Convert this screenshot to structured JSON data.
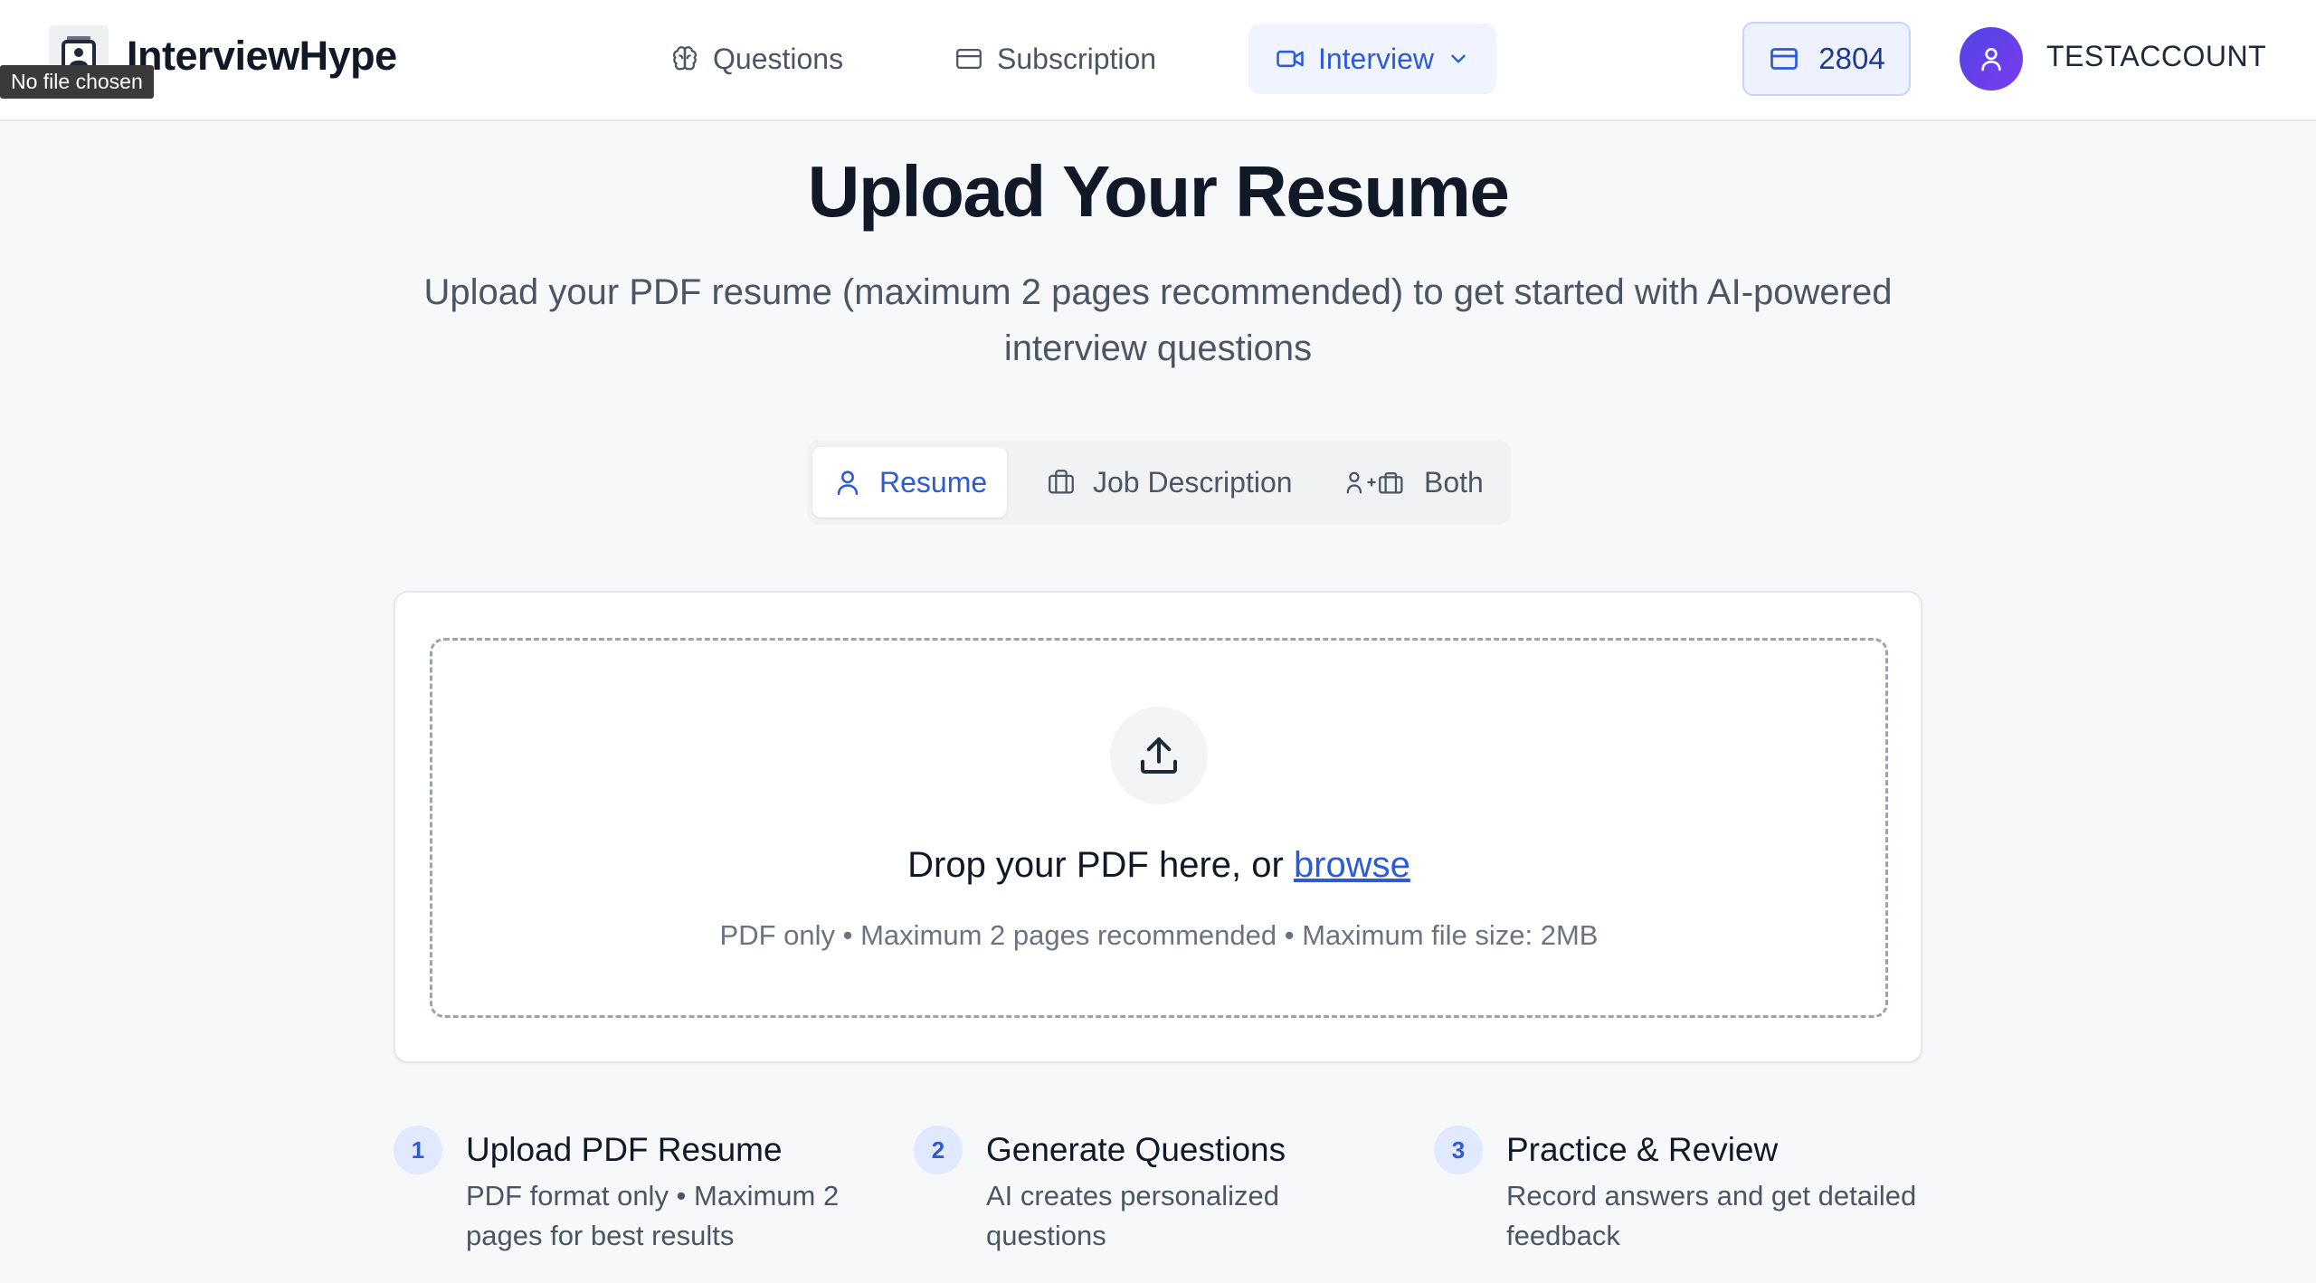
{
  "header": {
    "brand": "InterviewHype",
    "file_tooltip": "No file chosen",
    "nav": {
      "questions": "Questions",
      "subscription": "Subscription",
      "interview": "Interview"
    },
    "credits": "2804",
    "username": "TESTACCOUNT"
  },
  "hero": {
    "title": "Upload Your Resume",
    "subtitle": "Upload your PDF resume (maximum 2 pages recommended) to get started with AI-powered interview questions"
  },
  "tabs": {
    "resume": "Resume",
    "job_description": "Job Description",
    "both": "Both",
    "active": "Resume"
  },
  "upload": {
    "drop_text": "Drop your PDF here, or",
    "browse": "browse",
    "hint": "PDF only • Maximum 2 pages recommended • Maximum file size: 2MB"
  },
  "steps": [
    {
      "number": "1",
      "title": "Upload PDF Resume",
      "description": "PDF format only • Maximum 2 pages for best results"
    },
    {
      "number": "2",
      "title": "Generate Questions",
      "description": "AI creates personalized questions"
    },
    {
      "number": "3",
      "title": "Practice & Review",
      "description": "Record answers and get detailed feedback"
    }
  ],
  "colors": {
    "accent": "#2d5bd7",
    "accent_bg": "#eff4ff",
    "avatar_gradient_start": "#4f46e5",
    "avatar_gradient_end": "#7c3aed",
    "page_bg": "#f7f8fa"
  },
  "icons": {
    "logo": "resume-logo-icon",
    "questions": "brain-icon",
    "subscription": "credit-card-icon",
    "interview": "video-camera-icon",
    "credits": "credit-card-icon",
    "avatar": "user-icon",
    "upload": "upload-icon",
    "job": "briefcase-icon"
  }
}
